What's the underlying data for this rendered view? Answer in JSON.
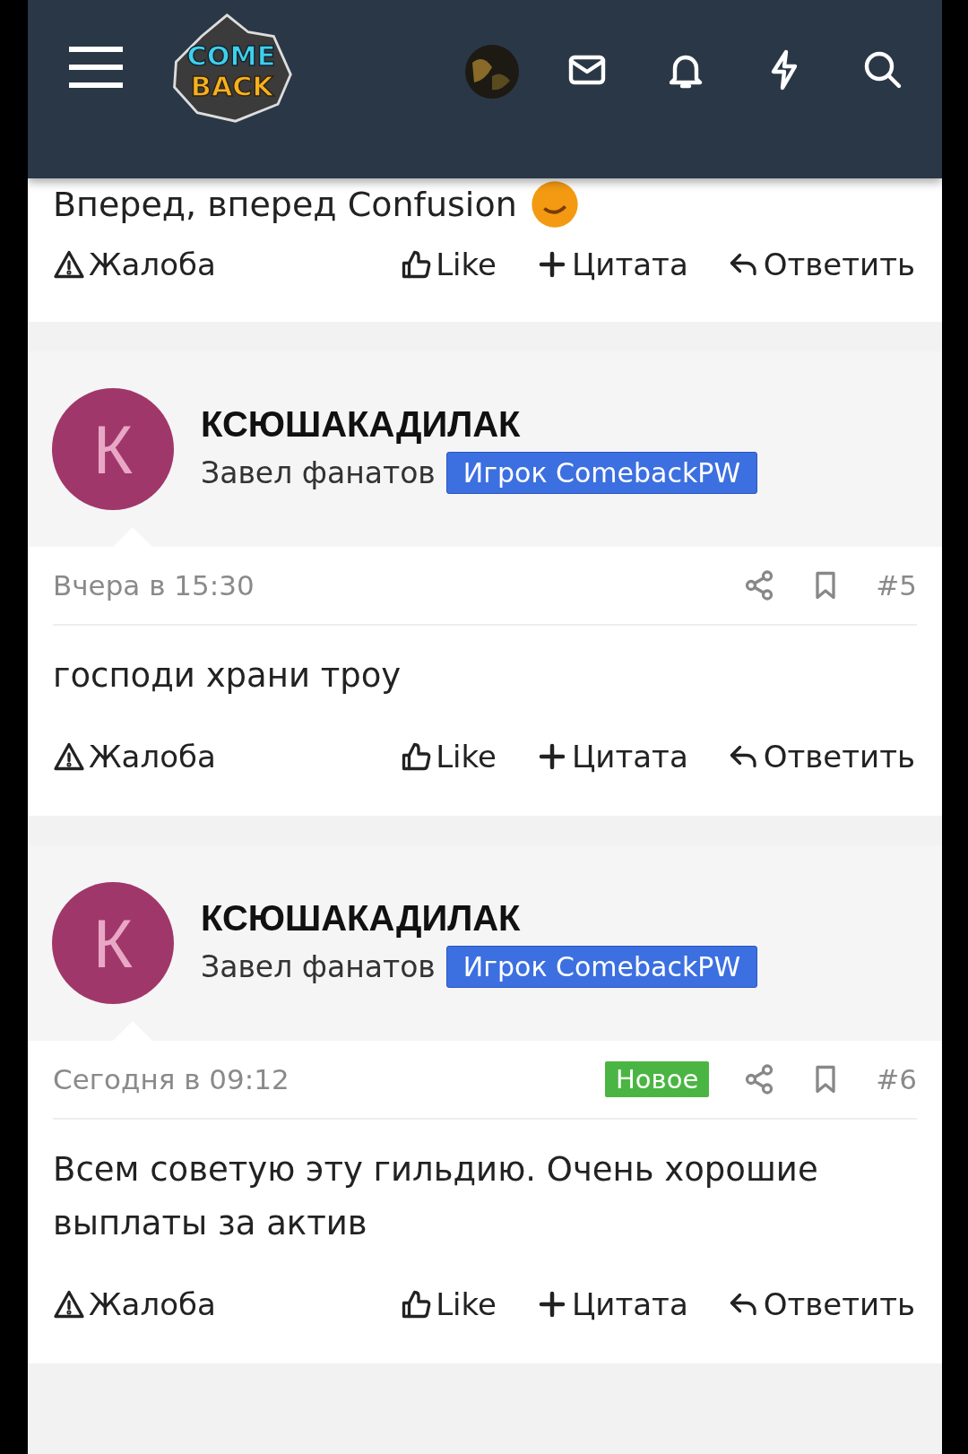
{
  "header": {
    "logo": {
      "line_1": "COME",
      "line_2": "BACK"
    }
  },
  "top_post": {
    "message": "Вперед, вперед Confusion",
    "actions": [
      {
        "kind": "report",
        "label": "Жалоба"
      },
      {
        "kind": "like",
        "label": "Like"
      },
      {
        "kind": "quote",
        "label": "Цитата"
      },
      {
        "kind": "reply",
        "label": "Ответить"
      }
    ]
  },
  "posts": [
    {
      "initial": "К",
      "author": "КСЮШАКАДИЛАК",
      "user_title": "Завел фанатов",
      "badge": "Игрок ComebackPW",
      "time": "Вчера в 15:30",
      "number": "#5",
      "message": "господи храни троу",
      "actions": [
        {
          "kind": "report",
          "label": "Жалоба"
        },
        {
          "kind": "like",
          "label": "Like"
        },
        {
          "kind": "quote",
          "label": "Цитата"
        },
        {
          "kind": "reply",
          "label": "Ответить"
        }
      ]
    },
    {
      "initial": "К",
      "author": "КСЮШАКАДИЛАК",
      "user_title": "Завел фанатов",
      "badge": "Игрок ComebackPW",
      "time": "Сегодня в 09:12",
      "new_badge": "Новое",
      "number": "#6",
      "message": "Всем советую эту гильдию. Очень хорошие выплаты за актив",
      "actions": [
        {
          "kind": "report",
          "label": "Жалоба"
        },
        {
          "kind": "like",
          "label": "Like"
        },
        {
          "kind": "quote",
          "label": "Цитата"
        },
        {
          "kind": "reply",
          "label": "Ответить"
        }
      ]
    }
  ]
}
